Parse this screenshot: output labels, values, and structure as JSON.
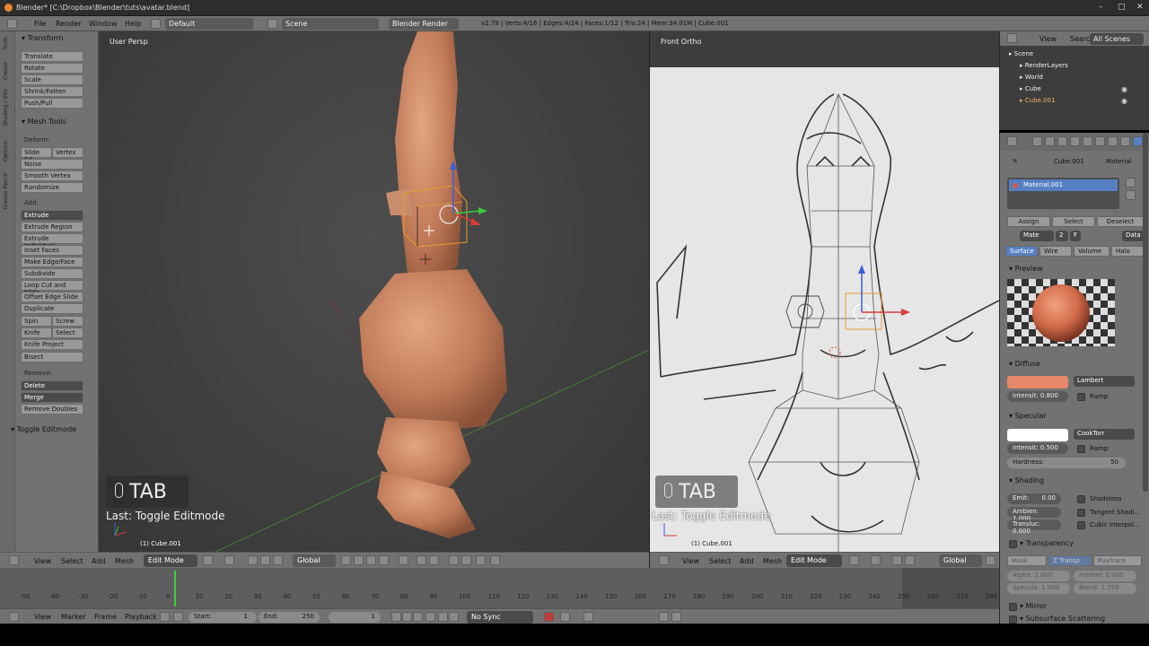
{
  "window": {
    "title": "Blender* [C:\\Dropbox\\Blender\\tuts\\avatar.blend]",
    "minimize": "–",
    "maximize": "□",
    "close": "✕"
  },
  "info_header": {
    "menus": [
      "File",
      "Render",
      "Window",
      "Help"
    ],
    "screen_layout": "Default",
    "scene": "Scene",
    "render_engine": "Blender Render",
    "stats": "v2.79 | Verts:4/16 | Edges:4/24 | Faces:1/12 | Tris:24 | Mem:34.01M | Cube.001"
  },
  "toolshelf": {
    "tabs": [
      "Tools",
      "Create",
      "Shading / UVs",
      "Options",
      "Grease Pencil"
    ],
    "transform_header": "Transform",
    "transform_buttons": [
      "Translate",
      "Rotate",
      "Scale",
      "Shrink/Fatten",
      "Push/Pull"
    ],
    "mesh_tools_header": "Mesh Tools",
    "deform_label": "Deform:",
    "slide_edge": "Slide Ed",
    "vertex": "Vertex",
    "noise": "Noise",
    "smooth_vertex": "Smooth Vertex",
    "randomize": "Randomize",
    "add_label": "Add:",
    "extrude": "Extrude",
    "extrude_region": "Extrude Region",
    "extrude_individual": "Extrude Individual",
    "inset_faces": "Inset Faces",
    "make_edge_face": "Make Edge/Face",
    "subdivide": "Subdivide",
    "loop_cut": "Loop Cut and Slide",
    "offset_edge": "Offset Edge Slide",
    "duplicate": "Duplicate",
    "spin": "Spin",
    "screw": "Screw",
    "knife": "Knife",
    "select": "Select",
    "knife_project": "Knife Project",
    "bisect": "Bisect",
    "remove_label": "Remove:",
    "delete": "Delete",
    "merge": "Merge",
    "remove_doubles": "Remove Doubles",
    "last_operator": "Toggle Editmode"
  },
  "viewport_left": {
    "label": "User Persp",
    "key_hint": "TAB",
    "last_op": "Last: Toggle Editmode",
    "object": "(1) Cube.001",
    "menus": [
      "View",
      "Select",
      "Add",
      "Mesh"
    ],
    "mode": "Edit Mode",
    "orientation": "Global"
  },
  "viewport_right": {
    "label": "Front Ortho",
    "key_hint": "TAB",
    "last_op": "Last: Toggle Editmode",
    "object": "(1) Cube.001",
    "menus": [
      "View",
      "Select",
      "Add",
      "Mesh"
    ],
    "mode": "Edit Mode",
    "orientation": "Global"
  },
  "timeline": {
    "ticks": [
      "-50",
      "-40",
      "-30",
      "-20",
      "-10",
      "0",
      "10",
      "20",
      "30",
      "40",
      "50",
      "60",
      "70",
      "80",
      "90",
      "100",
      "110",
      "120",
      "130",
      "140",
      "150",
      "160",
      "170",
      "180",
      "190",
      "200",
      "210",
      "220",
      "230",
      "240",
      "250",
      "260",
      "270",
      "280"
    ],
    "menus": [
      "View",
      "Marker",
      "Frame",
      "Playback"
    ],
    "start_label": "Start:",
    "start": "1",
    "end_label": "End:",
    "end": "250",
    "current": "1",
    "sync": "No Sync"
  },
  "outliner": {
    "menus": [
      "View",
      "Search"
    ],
    "filter": "All Scenes",
    "items": [
      "Scene",
      "RenderLayers",
      "World",
      "Cube",
      "Cube.001"
    ]
  },
  "properties": {
    "context_object": "Cube.001",
    "context_material": "Material",
    "material_slot": "Material.001",
    "assign": "Assign",
    "select": "Select",
    "deselect": "Deselect",
    "mat_name": "Mate",
    "users": "2",
    "fake": "F",
    "data": "Data",
    "tabs": [
      "Surface",
      "Wire",
      "Volume",
      "Halo"
    ],
    "preview": "Preview",
    "diffuse": "Diffuse",
    "diffuse_color": "#e6896a",
    "diffuse_shader": "Lambert",
    "diffuse_intensity": "Intensit: 0.800",
    "ramp": "Ramp",
    "specular": "Specular",
    "specular_shader": "CookTorr",
    "specular_intensity": "Intensit: 0.500",
    "hardness_label": "Hardness:",
    "hardness": "50",
    "shading": "Shading",
    "emit": "Emit:",
    "emit_val": "0.00",
    "shadeless": "Shadeless",
    "ambient": "Ambien: 1.000",
    "tangent": "Tangent Shadi...",
    "translucency": "Transluc: 0.000",
    "cubic": "Cubic Interpol...",
    "transparency": "Transparency",
    "mask": "Mask",
    "ztransp": "Z Transp",
    "raytrace": "Raytrace",
    "alpha": "Alpha: 1.000",
    "fresnel": "Fresnel: 0.000",
    "specular_t": "Specula: 1.000",
    "blend": "Blend: 1.250",
    "mirror": "Mirror",
    "sss": "Subsurface Scattering"
  }
}
